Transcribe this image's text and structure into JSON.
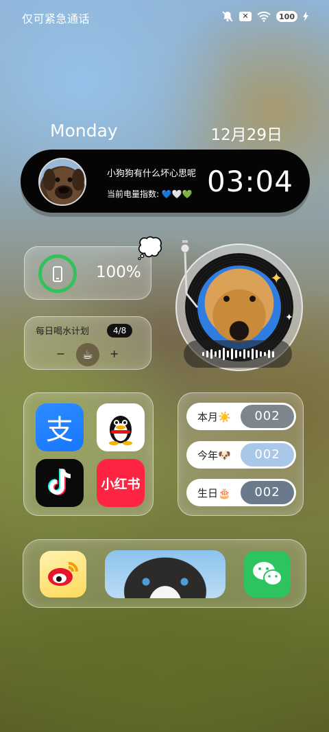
{
  "status_bar": {
    "carrier_text": "仅可紧急通话",
    "icons": [
      "mute-bell-icon",
      "no-sim-icon",
      "wifi-icon",
      "battery-icon",
      "charging-bolt-icon"
    ],
    "sim_glyph": "✕",
    "battery_level": "100"
  },
  "date_widget": {
    "day": "Monday",
    "date": "12月29日"
  },
  "pill_widget": {
    "line1": "小狗狗有什么坏心思呢",
    "line2": "当前电量指数: 💙🤍💚",
    "time": "03:04"
  },
  "battery_widget": {
    "percent": "100%",
    "ring_color": "#33c25a",
    "decor": "💭"
  },
  "water_widget": {
    "title": "每日喝水计划",
    "progress": "4/8",
    "minus": "−",
    "plus": "+",
    "cup": "☕"
  },
  "music_widget": {
    "sparkle_large": "✦",
    "sparkle_small": "✦",
    "wave_levels": [
      6,
      10,
      14,
      8,
      12,
      18,
      10,
      16,
      12,
      8,
      14,
      10,
      16,
      12,
      8,
      6,
      12,
      9
    ]
  },
  "apps": [
    {
      "name": "alipay",
      "glyph": "支",
      "color": "#1677ff"
    },
    {
      "name": "qq",
      "glyph": "",
      "color": "#ffffff"
    },
    {
      "name": "douyin",
      "glyph": "♪",
      "color": "#0a0a0a"
    },
    {
      "name": "xiaohongshu",
      "glyph": "小红书",
      "color": "#ff2442"
    }
  ],
  "counters": [
    {
      "label": "本月",
      "emoji": "☀️",
      "value": "002",
      "color": "#7f858c"
    },
    {
      "label": "今年",
      "emoji": "🐶",
      "value": "002",
      "color": "#a9c8e8"
    },
    {
      "label": "生日",
      "emoji": "🎂",
      "value": "002",
      "color": "#6b7a8a"
    }
  ],
  "dock": {
    "left_app": "weibo",
    "right_app": "wechat"
  }
}
